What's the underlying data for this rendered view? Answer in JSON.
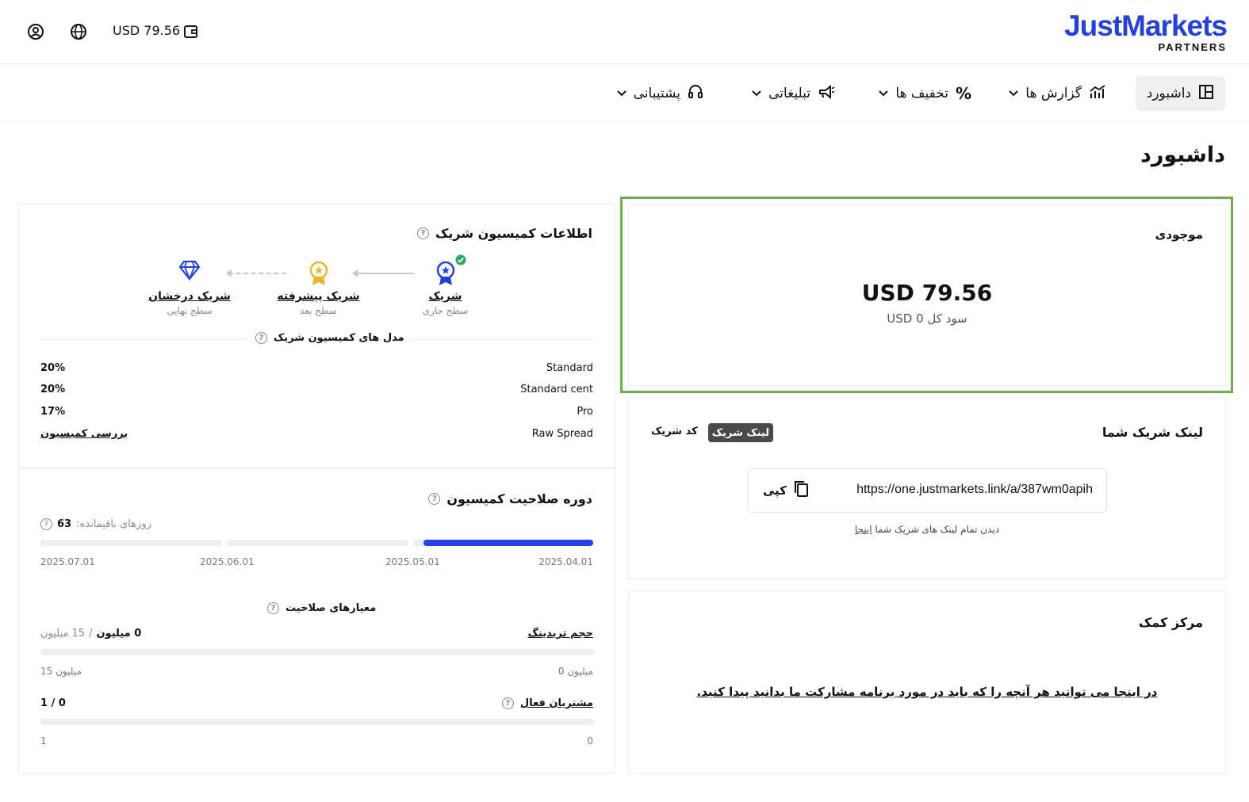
{
  "topbar": {
    "balance": "USD 79.56",
    "logo_brand": "JustMarkets",
    "logo_sub": "PARTNERS"
  },
  "nav": {
    "items": [
      {
        "label": "داشبورد",
        "icon": "dashboard-icon"
      },
      {
        "label": "گزارش ها",
        "icon": "chart-icon"
      },
      {
        "label": "تخفیف ها",
        "icon": "percent-icon"
      },
      {
        "label": "تبلیغاتی",
        "icon": "megaphone-icon"
      },
      {
        "label": "پشتیبانی",
        "icon": "headset-icon"
      }
    ]
  },
  "page": {
    "title": "داشبورد"
  },
  "balance_card": {
    "title": "موجودی",
    "amount": "USD 79.56",
    "total_profit": "سود کل USD 0"
  },
  "partner_link": {
    "title": "لینک شریک شما",
    "tab_link": "لینک شریک",
    "tab_code": "کد شریک",
    "url": "https://one.justmarkets.link/a/387wm0apih",
    "copy": "کپی",
    "see_all_prefix": "دیدن تمام لینک های شریک شما",
    "see_all_link": "اینجا"
  },
  "help_center": {
    "title": "مرکز کمک",
    "text": "در اینجا می توانید هر آنچه را که باید در مورد برنامه مشارکت ما بدانید پیدا کنید."
  },
  "commission": {
    "title": "اطلاعات کمیسیون شریک",
    "levels": [
      {
        "name": "شریک",
        "sub": "سطح جاری",
        "icon": "ribbon-icon",
        "color": "#2541d8"
      },
      {
        "name": "شریک پیشرفته",
        "sub": "سطح بعد",
        "icon": "medal-icon",
        "color": "#e9b52a"
      },
      {
        "name": "شریک درخشان",
        "sub": "سطح نهایی",
        "icon": "diamond-icon",
        "color": "#2541d8"
      }
    ],
    "models_title": "مدل های کمیسیون شریک",
    "models": [
      {
        "name": "Standard",
        "value": "20%"
      },
      {
        "name": "Standard cent",
        "value": "20%"
      },
      {
        "name": "Pro",
        "value": "17%"
      },
      {
        "name": "Raw Spread",
        "value": "بررسی کمیسیون"
      }
    ]
  },
  "qualification": {
    "title": "دوره صلاحیت کمیسیون",
    "days_label": "روزهای باقیمانده:",
    "days_value": "63",
    "dates": [
      "2025.04.01",
      "2025.05.01",
      "2025.06.01",
      "2025.07.01"
    ],
    "progress_first_month": 1.0,
    "criteria_title": "معیارهای صلاحیت",
    "volume": {
      "label": "حجم تریدینگ",
      "current": "0 میلیون",
      "sep": "/",
      "target": "15 میلیون",
      "min": "0 میلیون",
      "max": "15 میلیون",
      "progress": 0
    },
    "clients": {
      "label": "مشتریان فعال",
      "value": "0 / 1",
      "min": "0",
      "max": "1",
      "progress": 0
    }
  },
  "colors": {
    "brand": "#2541d8",
    "accent_bar": "#2541e8",
    "frame": "#6ab04c"
  }
}
